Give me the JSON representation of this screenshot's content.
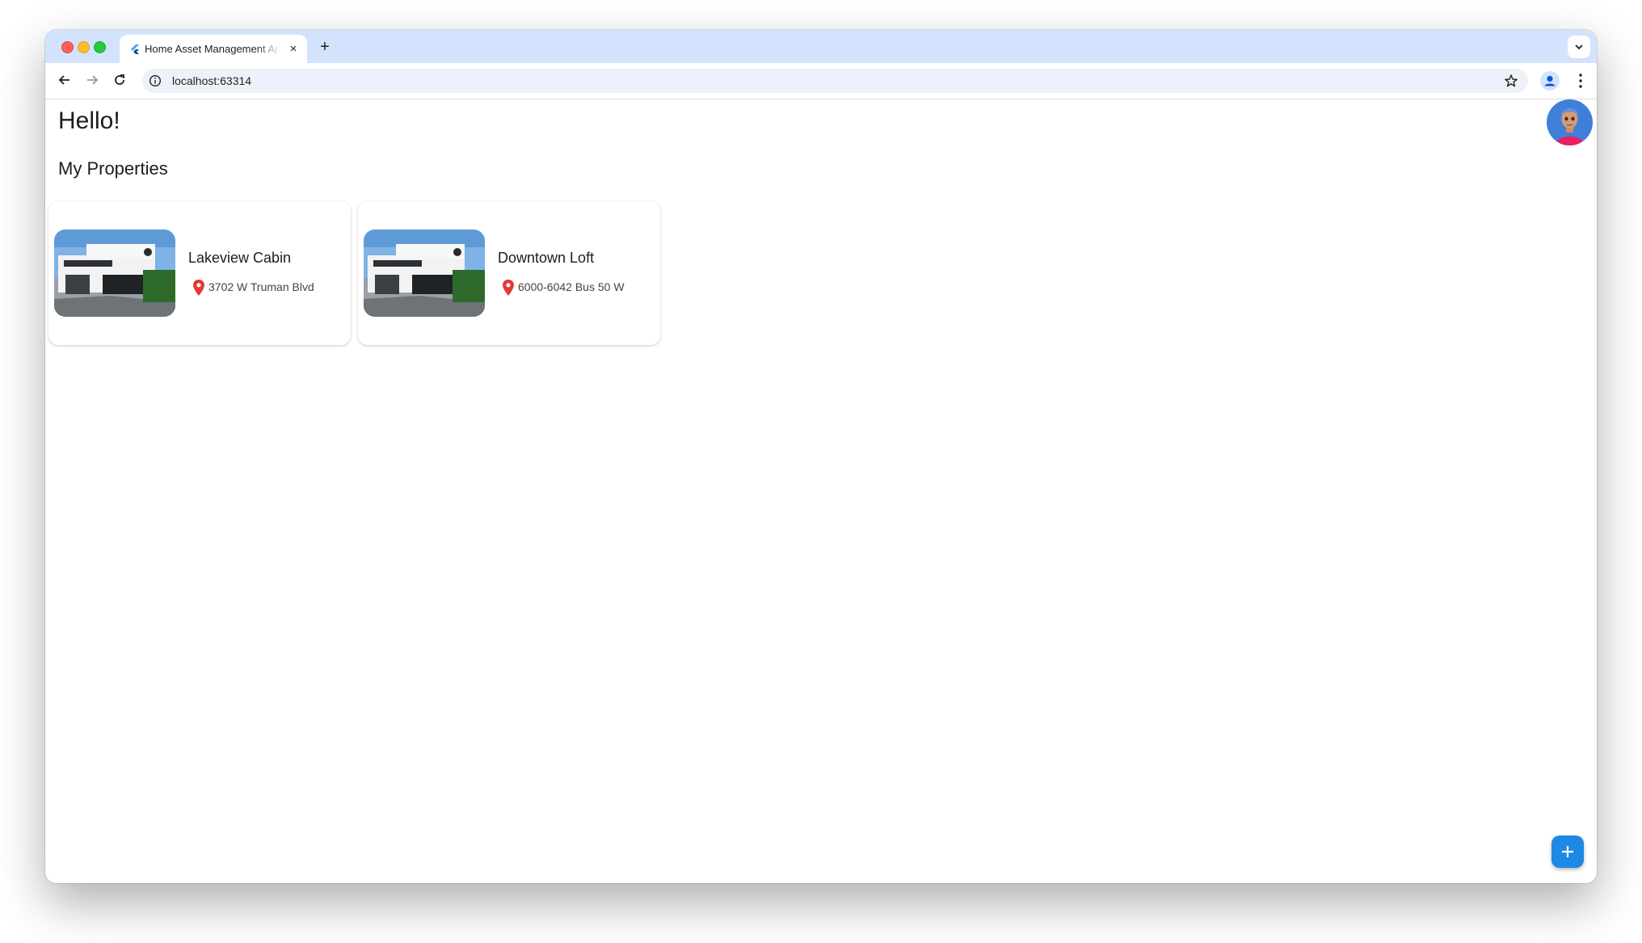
{
  "browser": {
    "tab_title": "Home Asset Management App",
    "tab_close_glyph": "×",
    "new_tab_glyph": "+",
    "url": "localhost:63314"
  },
  "page": {
    "greeting": "Hello!",
    "section_title": "My Properties",
    "properties": [
      {
        "name": "Lakeview Cabin",
        "address": "3702 W Truman Blvd",
        "icon": "location-pin-icon"
      },
      {
        "name": "Downtown Loft",
        "address": "6000-6042 Bus 50 W",
        "icon": "location-pin-icon"
      }
    ],
    "fab_icon": "add-icon"
  },
  "colors": {
    "tab_strip": "#d3e3fd",
    "fab": "#1e88e5",
    "pin": "#e53935",
    "avatar_bg": "#3f7fd8"
  }
}
